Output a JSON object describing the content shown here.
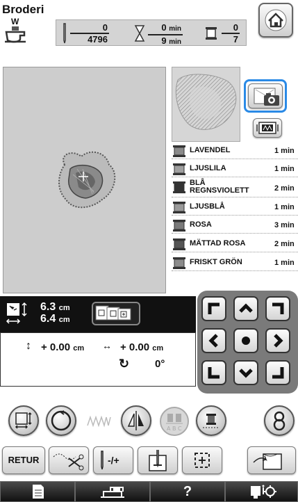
{
  "header": {
    "title": "Broderi",
    "foot_letter": "W",
    "stitch_count": "0",
    "stitch_total": "4796",
    "time_current": "0",
    "time_unit_1": "min",
    "time_total": "9",
    "time_unit_2": "min",
    "color_current": "0",
    "color_total": "7"
  },
  "threads": [
    {
      "name": "LAVENDEL",
      "time": "1 min",
      "color": "#8a8a8a"
    },
    {
      "name": "LJUSLILA",
      "time": "1 min",
      "color": "#a0a0a0"
    },
    {
      "name": "BLÅ\nREGNSVIOLETT",
      "time": "2 min",
      "color": "#333333"
    },
    {
      "name": "LJUSBLÅ",
      "time": "1 min",
      "color": "#9a9a9a"
    },
    {
      "name": "ROSA",
      "time": "3 min",
      "color": "#7a7a7a"
    },
    {
      "name": "MÄTTAD ROSA",
      "time": "2 min",
      "color": "#555555"
    },
    {
      "name": "FRISKT GRÖN",
      "time": "1 min",
      "color": "#8c8c8c"
    }
  ],
  "size": {
    "height_value": "6.3",
    "height_unit": "cm",
    "width_value": "6.4",
    "width_unit": "cm"
  },
  "position": {
    "vertical_value": "+ 0.00",
    "vertical_unit": "cm",
    "horizontal_value": "+ 0.00",
    "horizontal_unit": "cm",
    "rotation_value": "0°"
  },
  "bottom_row": {
    "retur_label": "RETUR",
    "needle_label": "-/+"
  },
  "footer": {
    "help_label": "?"
  },
  "colors": {
    "accent_blue": "#2a8ae6",
    "panel_gray": "#cfcfcf",
    "dark_panel": "#111111"
  }
}
